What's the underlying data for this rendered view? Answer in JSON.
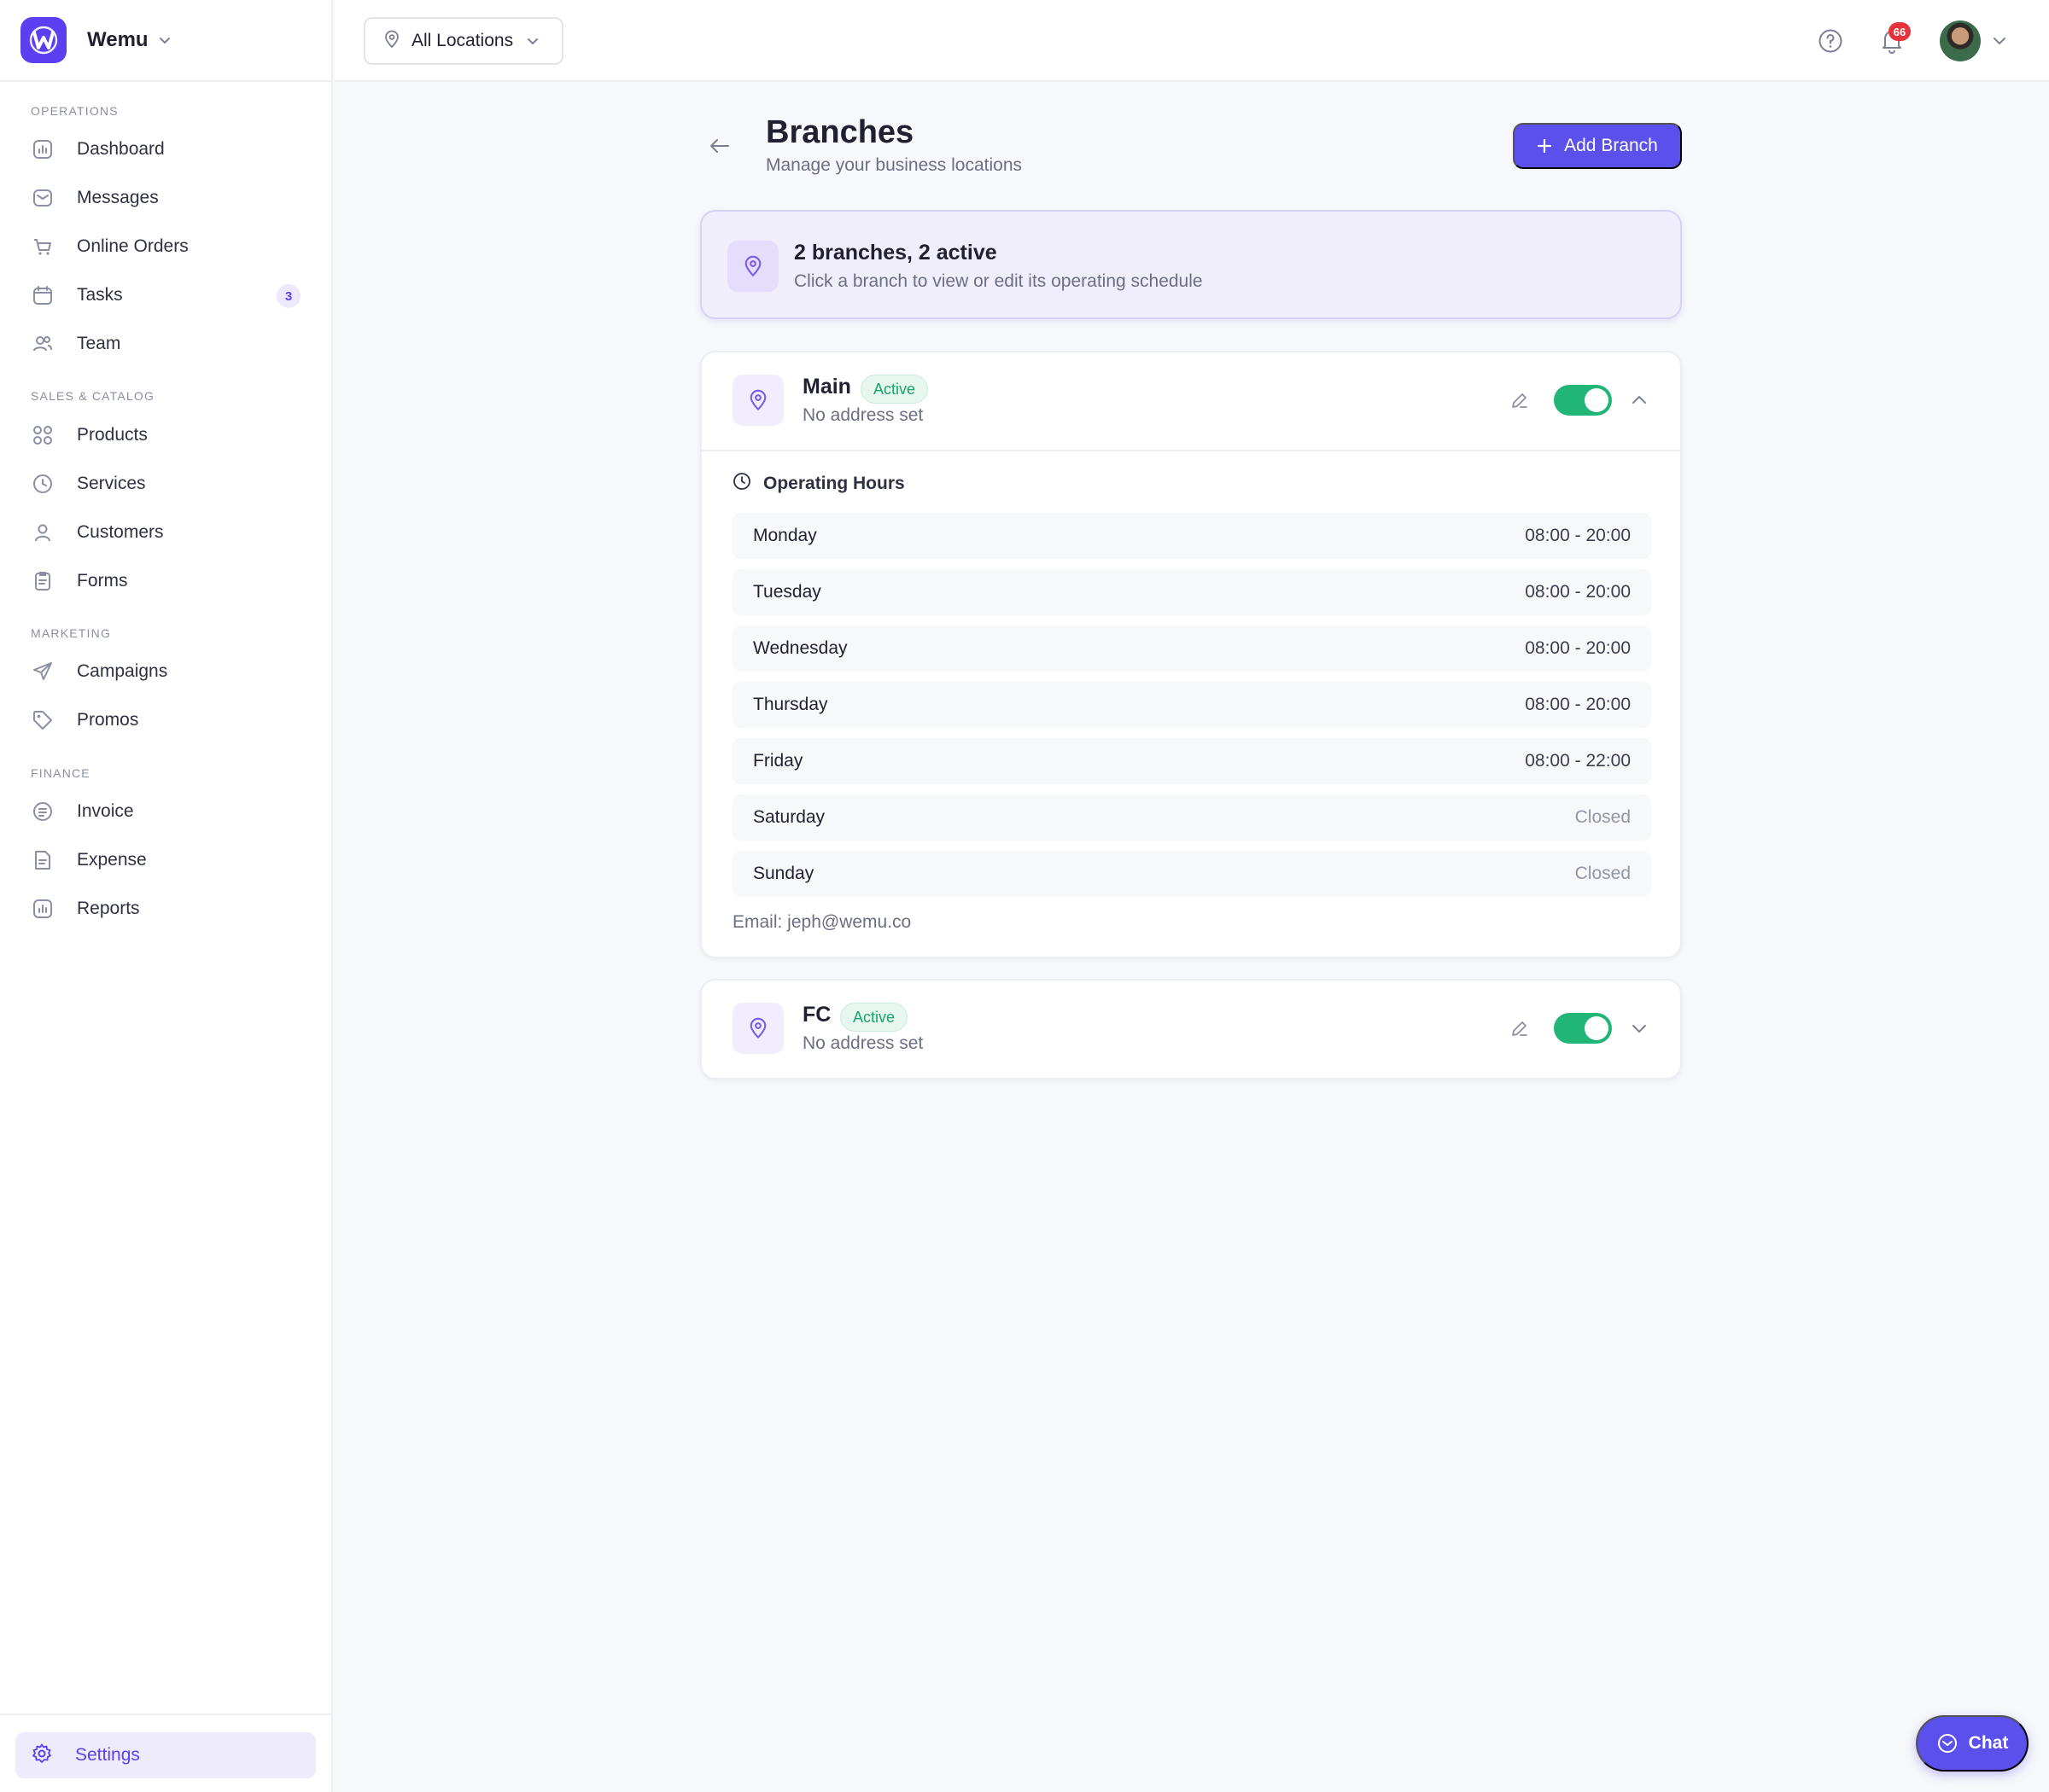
{
  "brand": {
    "name": "Wemu"
  },
  "sidebar": {
    "sections": [
      {
        "label": "Operations",
        "items": [
          {
            "label": "Dashboard",
            "icon": "chart-icon"
          },
          {
            "label": "Messages",
            "icon": "mail-icon"
          },
          {
            "label": "Online Orders",
            "icon": "cart-icon"
          },
          {
            "label": "Tasks",
            "icon": "calendar-icon",
            "badge": "3"
          },
          {
            "label": "Team",
            "icon": "users-icon"
          }
        ]
      },
      {
        "label": "Sales & Catalog",
        "items": [
          {
            "label": "Products",
            "icon": "grid-icon"
          },
          {
            "label": "Services",
            "icon": "clock-icon"
          },
          {
            "label": "Customers",
            "icon": "user-icon"
          },
          {
            "label": "Forms",
            "icon": "clipboard-icon"
          }
        ]
      },
      {
        "label": "Marketing",
        "items": [
          {
            "label": "Campaigns",
            "icon": "send-icon"
          },
          {
            "label": "Promos",
            "icon": "tag-icon"
          }
        ]
      },
      {
        "label": "Finance",
        "items": [
          {
            "label": "Invoice",
            "icon": "invoice-icon"
          },
          {
            "label": "Expense",
            "icon": "expense-icon"
          },
          {
            "label": "Reports",
            "icon": "chart-icon"
          }
        ]
      }
    ],
    "settings_label": "Settings"
  },
  "topbar": {
    "location_label": "All Locations",
    "notification_count": "66"
  },
  "page": {
    "title": "Branches",
    "subtitle": "Manage your business locations",
    "add_button": "Add Branch"
  },
  "summary": {
    "title": "2 branches, 2 active",
    "subtitle": "Click a branch to view or edit its operating schedule"
  },
  "branches": [
    {
      "name": "Main",
      "status": "Active",
      "address": "No address set",
      "expanded": true,
      "hours_title": "Operating Hours",
      "hours": [
        {
          "day": "Monday",
          "time": "08:00 - 20:00"
        },
        {
          "day": "Tuesday",
          "time": "08:00 - 20:00"
        },
        {
          "day": "Wednesday",
          "time": "08:00 - 20:00"
        },
        {
          "day": "Thursday",
          "time": "08:00 - 20:00"
        },
        {
          "day": "Friday",
          "time": "08:00 - 22:00"
        },
        {
          "day": "Saturday",
          "time": "Closed"
        },
        {
          "day": "Sunday",
          "time": "Closed"
        }
      ],
      "email": "Email: jeph@wemu.co"
    },
    {
      "name": "FC",
      "status": "Active",
      "address": "No address set",
      "expanded": false
    }
  ],
  "chat": {
    "label": "Chat"
  },
  "colors": {
    "accent": "#5b50ec",
    "brand": "#5b3ff0",
    "success": "#1fb677",
    "danger": "#e5323b"
  }
}
